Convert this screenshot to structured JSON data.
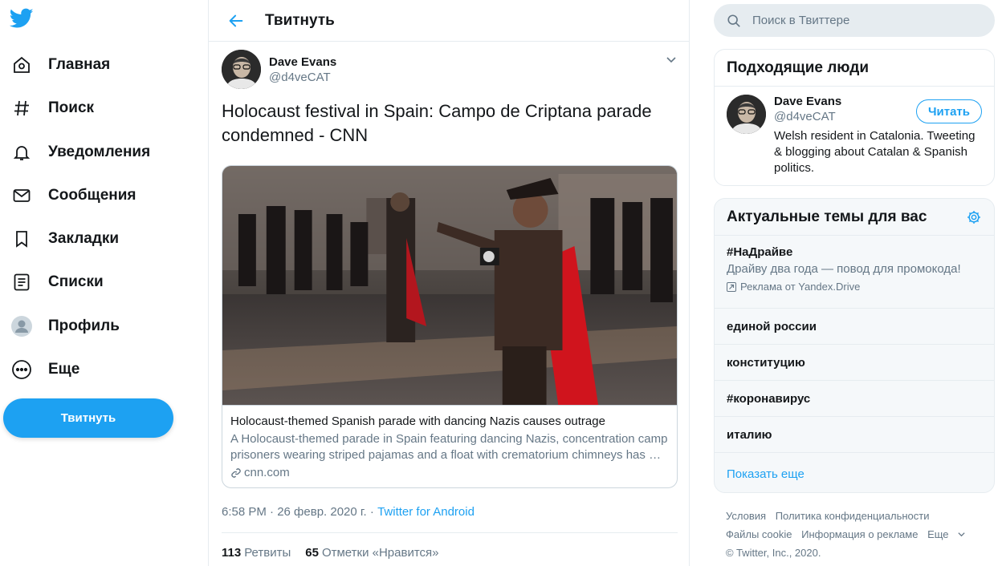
{
  "nav": {
    "items": [
      {
        "label": "Главная",
        "icon": "home-icon"
      },
      {
        "label": "Поиск",
        "icon": "hashtag-icon"
      },
      {
        "label": "Уведомления",
        "icon": "bell-icon"
      },
      {
        "label": "Сообщения",
        "icon": "envelope-icon"
      },
      {
        "label": "Закладки",
        "icon": "bookmark-icon"
      },
      {
        "label": "Списки",
        "icon": "list-icon"
      },
      {
        "label": "Профиль",
        "icon": "profile-icon"
      },
      {
        "label": "Еще",
        "icon": "more-icon"
      }
    ],
    "tweet_button": "Твитнуть"
  },
  "main": {
    "title": "Твитнуть",
    "author": {
      "name": "Dave Evans",
      "handle": "@d4veCAT"
    },
    "text": "Holocaust festival in Spain: Campo de Criptana parade condemned - CNN",
    "card": {
      "title": "Holocaust-themed Spanish parade with dancing Nazis causes outrage",
      "description": "A Holocaust-themed parade in Spain featuring dancing Nazis, concentration camp prisoners wearing striped pajamas and a float with crematorium chimneys has …",
      "domain": "cnn.com"
    },
    "meta": {
      "time": "6:58 PM · 26 февр. 2020 г. · ",
      "source": "Twitter for Android"
    },
    "stats": {
      "retweets_count": "113",
      "retweets_label": "Ретвиты",
      "likes_count": "65",
      "likes_label": "Отметки «Нравится»"
    }
  },
  "search": {
    "placeholder": "Поиск в Твиттере"
  },
  "who_to_follow": {
    "title": "Подходящие люди",
    "user": {
      "name": "Dave Evans",
      "handle": "@d4veCAT",
      "bio": "Welsh resident in Catalonia. Tweeting & blogging about Catalan & Spanish politics.",
      "follow_label": "Читать"
    }
  },
  "trends": {
    "title": "Актуальные темы для вас",
    "promoted": {
      "name": "#НаДрайве",
      "subtitle": "Драйву два года — повод для промокода!",
      "promo": "Реклама от Yandex.Drive"
    },
    "items": [
      "единой россии",
      "конституцию",
      "#коронавирус",
      "италию"
    ],
    "show_more": "Показать еще"
  },
  "footer": {
    "links_row1": [
      "Условия",
      "Политика конфиденциальности"
    ],
    "links_row2": [
      "Файлы cookie",
      "Информация о рекламе",
      "Еще"
    ],
    "copyright": "© Twitter, Inc., 2020."
  },
  "colors": {
    "accent": "#1da1f2",
    "text": "#14171a",
    "muted": "#657786",
    "border": "#e6ecf0"
  }
}
